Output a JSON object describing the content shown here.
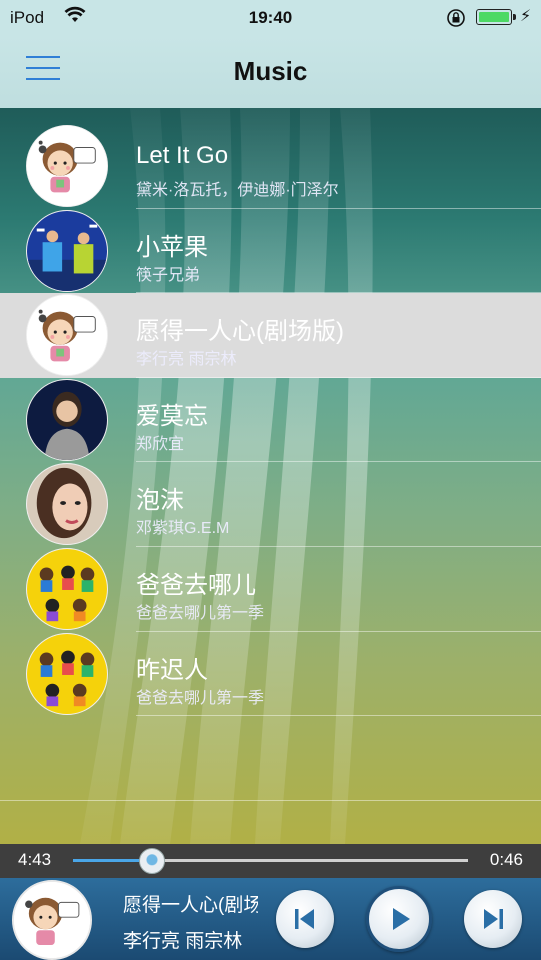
{
  "status": {
    "carrier": "iPod",
    "time": "19:40",
    "battery_color": "#4cd964"
  },
  "nav": {
    "title": "Music",
    "menu_icon": "hamburger-menu-icon"
  },
  "songs": [
    {
      "title": "Let It Go",
      "artist": "黛米·洛瓦托，伊迪娜·门泽尔",
      "cover": "cartoon-girl-listen-to-music",
      "selected": false
    },
    {
      "title": "小苹果",
      "artist": "筷子兄弟",
      "cover": "duo-concert-stage",
      "selected": false
    },
    {
      "title": "愿得一人心(剧场版)",
      "artist": "李行亮 雨宗林",
      "cover": "cartoon-girl-listen-to-music",
      "selected": true
    },
    {
      "title": "爱莫忘",
      "artist": "郑欣宜",
      "cover": "singer-portrait-dark",
      "selected": false
    },
    {
      "title": "泡沫",
      "artist": "邓紫琪G.E.M",
      "cover": "singer-portrait-face",
      "selected": false
    },
    {
      "title": "爸爸去哪儿",
      "artist": "爸爸去哪儿第一季",
      "cover": "cartoon-kids-yellow",
      "selected": false
    },
    {
      "title": "昨迟人",
      "artist": "爸爸去哪儿第一季",
      "cover": "cartoon-kids-yellow",
      "selected": false
    }
  ],
  "player": {
    "elapsed": "4:43",
    "total": "0:46",
    "progress": 0.2,
    "now_playing_title": "愿得一人心(剧场版)",
    "now_playing_artist": "李行亮 雨宗林",
    "accent_color": "#4aa6e8"
  }
}
